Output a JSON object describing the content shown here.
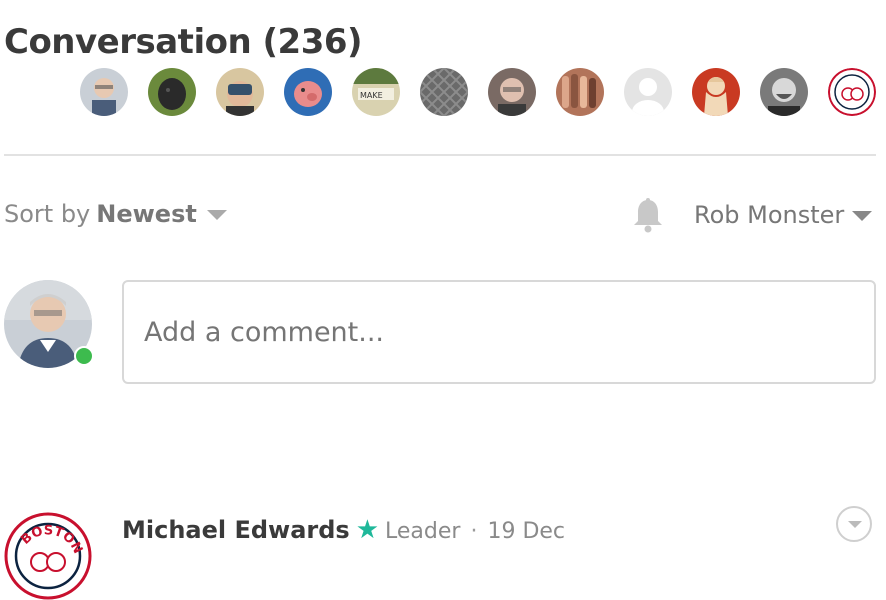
{
  "conversation": {
    "title": "Conversation (236)",
    "participants": [
      {
        "name": "participant-1",
        "bg": "#c9cfd6",
        "fg": "#e7c9b2"
      },
      {
        "name": "participant-2",
        "bg": "#6b8a3c",
        "fg": "#2a2a2a"
      },
      {
        "name": "participant-3",
        "bg": "#d8c6a0",
        "fg": "#35506b"
      },
      {
        "name": "participant-4",
        "bg": "#2f6db5",
        "fg": "#e98c8c"
      },
      {
        "name": "participant-5",
        "bg": "#d9d2b0",
        "fg": "#4a5a3a"
      },
      {
        "name": "participant-6",
        "bg": "#6a6a6a",
        "fg": "#8c8c8c"
      },
      {
        "name": "participant-7",
        "bg": "#7a6a64",
        "fg": "#e0c0b0"
      },
      {
        "name": "participant-8",
        "bg": "#b2745a",
        "fg": "#dca68a"
      },
      {
        "name": "participant-9",
        "bg": "#e4e4e4",
        "fg": "#ffffff"
      },
      {
        "name": "participant-10",
        "bg": "#c93a22",
        "fg": "#f2d9b8"
      },
      {
        "name": "participant-11",
        "bg": "#7a7a7a",
        "fg": "#d8d8d8"
      },
      {
        "name": "participant-12",
        "bg": "#ffffff",
        "fg": "#c8102e"
      }
    ]
  },
  "sort": {
    "label": "Sort by",
    "value": "Newest"
  },
  "notifications": {
    "icon": "bell-icon"
  },
  "user": {
    "name": "Rob Monster",
    "online_color": "#3dbb4e"
  },
  "composer": {
    "placeholder": "Add a comment..."
  },
  "comments": [
    {
      "author": "Michael Edwards",
      "role": "Leader",
      "date": "19 Dec",
      "separator": "·",
      "star_color": "#1fb89a"
    }
  ]
}
